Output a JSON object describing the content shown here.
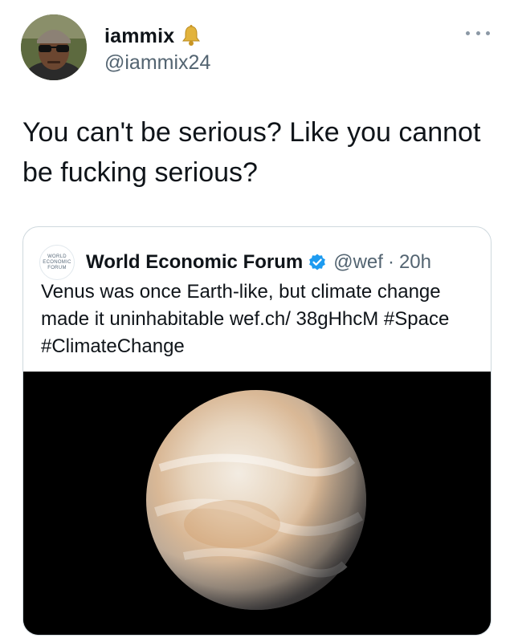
{
  "tweet": {
    "display_name": "iammix",
    "handle": "@iammix24",
    "text": "You can't be serious? Like you cannot be fucking serious?"
  },
  "quote": {
    "name": "World Economic Forum",
    "handle": "@wef",
    "separator": "·",
    "time": "20h",
    "avatar_text": [
      "WORLD",
      "ECONOMIC",
      "FORUM"
    ],
    "text": "Venus was once Earth-like, but climate change made it uninhabitable wef.ch/ 38gHhcM #Space #ClimateChange"
  },
  "icons": {
    "bell": "bell-icon",
    "verified": "verified-badge-icon",
    "more": "more-options-icon"
  },
  "colors": {
    "secondary_text": "#536471",
    "verified_blue": "#1d9bf0",
    "bell_gold": "#e2b33c",
    "border": "#cfd9de"
  }
}
